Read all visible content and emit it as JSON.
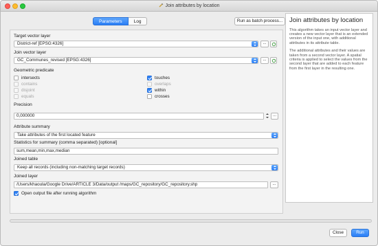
{
  "window": {
    "title": "Join attributes by location"
  },
  "tabs": [
    {
      "label": "Parameters",
      "active": true
    },
    {
      "label": "Log",
      "active": false
    }
  ],
  "batch_button": "Run as batch process...",
  "target_layer": {
    "label": "Target vector layer",
    "value": "District-ref [EPSG:4326]"
  },
  "join_layer": {
    "label": "Join vector layer",
    "value": "GC_Communes_revised [EPSG:4326]"
  },
  "predicate": {
    "label": "Geometric predicate",
    "options": [
      {
        "label": "intersects",
        "checked": false,
        "enabled": true
      },
      {
        "label": "contains",
        "checked": false,
        "enabled": false
      },
      {
        "label": "disjoint",
        "checked": false,
        "enabled": false
      },
      {
        "label": "equals",
        "checked": false,
        "enabled": false
      },
      {
        "label": "touches",
        "checked": true,
        "enabled": true
      },
      {
        "label": "overlaps",
        "checked": false,
        "enabled": false
      },
      {
        "label": "within",
        "checked": true,
        "enabled": true
      },
      {
        "label": "crosses",
        "checked": false,
        "enabled": true
      }
    ]
  },
  "precision": {
    "label": "Precision",
    "value": "0,000000"
  },
  "attribute_summary": {
    "label": "Attribute summary",
    "value": "Take attributes of the first located feature"
  },
  "statistics": {
    "label": "Statistics for summary (comma separated) [optional]",
    "value": "sum,mean,min,max,median"
  },
  "joined_table": {
    "label": "Joined table",
    "value": "Keep all records (including non-matching target records)"
  },
  "joined_layer": {
    "label": "Joined layer",
    "value": "/Users/khaoula/Google Drive/ARTICLE 3/Data/output /maps/GC_repository/GC_repository.shp"
  },
  "open_output": {
    "label": "Open output file after running algorithm",
    "checked": true
  },
  "browse_label": "...",
  "help": {
    "title": "Join attributes by location",
    "paragraphs": [
      "This algorithm takes an input vector layer and creates a new vector layer that is an extended version of the input one, with additional attributes in its attribute table.",
      "The additional attributes and their values are taken from a second vector layer. A spatial criteria is applied to select the values from the second layer that are added to each feature from the first layer in the resulting one."
    ]
  },
  "progress": {
    "percent": 0
  },
  "buttons": {
    "close": "Close",
    "run": "Run"
  },
  "colors": {
    "accent": "#2d80f5",
    "window_bg": "#ececec"
  }
}
